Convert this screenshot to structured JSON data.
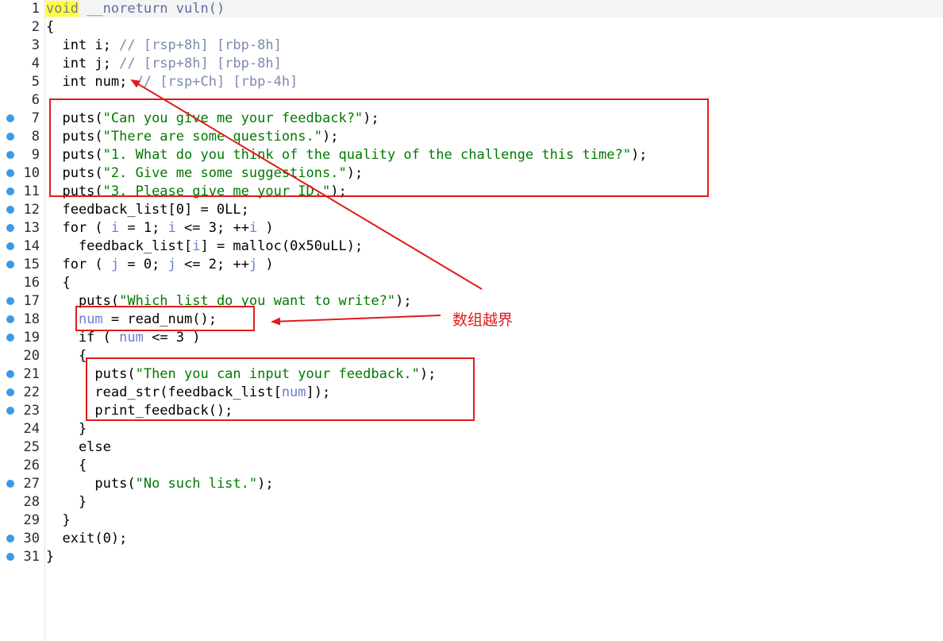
{
  "editor": {
    "lines": [
      {
        "num": "1",
        "bp": false,
        "tokens": [
          {
            "t": "void",
            "c": "kh"
          },
          {
            "t": " __noreturn vuln()",
            "c": "k"
          }
        ]
      },
      {
        "num": "2",
        "bp": false,
        "tokens": [
          {
            "t": "{",
            "c": "p"
          }
        ]
      },
      {
        "num": "3",
        "bp": false,
        "tokens": [
          {
            "t": "  int i; ",
            "c": "p"
          },
          {
            "t": "// [rsp+8h] [rbp-8h]",
            "c": "c"
          }
        ]
      },
      {
        "num": "4",
        "bp": false,
        "tokens": [
          {
            "t": "  int j; ",
            "c": "p"
          },
          {
            "t": "// [rsp+8h] [rbp-8h]",
            "c": "c"
          }
        ]
      },
      {
        "num": "5",
        "bp": false,
        "tokens": [
          {
            "t": "  int num; ",
            "c": "p"
          },
          {
            "t": "// [rsp+Ch] [rbp-4h]",
            "c": "c"
          }
        ]
      },
      {
        "num": "6",
        "bp": false,
        "tokens": []
      },
      {
        "num": "7",
        "bp": true,
        "tokens": [
          {
            "t": "  puts(",
            "c": "p"
          },
          {
            "t": "\"Can you give me your feedback?\"",
            "c": "s"
          },
          {
            "t": ");",
            "c": "p"
          }
        ]
      },
      {
        "num": "8",
        "bp": true,
        "tokens": [
          {
            "t": "  puts(",
            "c": "p"
          },
          {
            "t": "\"There are some questions.\"",
            "c": "s"
          },
          {
            "t": ");",
            "c": "p"
          }
        ]
      },
      {
        "num": "9",
        "bp": true,
        "tokens": [
          {
            "t": "  puts(",
            "c": "p"
          },
          {
            "t": "\"1. What do you think of the quality of the challenge this time?\"",
            "c": "s"
          },
          {
            "t": ");",
            "c": "p"
          }
        ]
      },
      {
        "num": "10",
        "bp": true,
        "tokens": [
          {
            "t": "  puts(",
            "c": "p"
          },
          {
            "t": "\"2. Give me some suggestions.\"",
            "c": "s"
          },
          {
            "t": ");",
            "c": "p"
          }
        ]
      },
      {
        "num": "11",
        "bp": true,
        "tokens": [
          {
            "t": "  puts(",
            "c": "p"
          },
          {
            "t": "\"3. Please give me your ID.\"",
            "c": "s"
          },
          {
            "t": ");",
            "c": "p"
          }
        ]
      },
      {
        "num": "12",
        "bp": true,
        "tokens": [
          {
            "t": "  feedback_list[0] = 0LL;",
            "c": "p"
          }
        ]
      },
      {
        "num": "13",
        "bp": true,
        "tokens": [
          {
            "t": "  for ( ",
            "c": "p"
          },
          {
            "t": "i",
            "c": "v"
          },
          {
            "t": " = 1; ",
            "c": "p"
          },
          {
            "t": "i",
            "c": "v"
          },
          {
            "t": " <= 3; ++",
            "c": "p"
          },
          {
            "t": "i",
            "c": "v"
          },
          {
            "t": " )",
            "c": "p"
          }
        ]
      },
      {
        "num": "14",
        "bp": true,
        "tokens": [
          {
            "t": "    feedback_list[",
            "c": "p"
          },
          {
            "t": "i",
            "c": "v"
          },
          {
            "t": "] = malloc(0x50uLL);",
            "c": "p"
          }
        ]
      },
      {
        "num": "15",
        "bp": true,
        "tokens": [
          {
            "t": "  for ( ",
            "c": "p"
          },
          {
            "t": "j",
            "c": "v"
          },
          {
            "t": " = 0; ",
            "c": "p"
          },
          {
            "t": "j",
            "c": "v"
          },
          {
            "t": " <= 2; ++",
            "c": "p"
          },
          {
            "t": "j",
            "c": "v"
          },
          {
            "t": " )",
            "c": "p"
          }
        ]
      },
      {
        "num": "16",
        "bp": false,
        "tokens": [
          {
            "t": "  {",
            "c": "p"
          }
        ]
      },
      {
        "num": "17",
        "bp": true,
        "tokens": [
          {
            "t": "    puts(",
            "c": "p"
          },
          {
            "t": "\"Which list do you want to write?\"",
            "c": "s"
          },
          {
            "t": ");",
            "c": "p"
          }
        ]
      },
      {
        "num": "18",
        "bp": true,
        "tokens": [
          {
            "t": "    ",
            "c": "p"
          },
          {
            "t": "num",
            "c": "v"
          },
          {
            "t": " = read_num();",
            "c": "p"
          }
        ]
      },
      {
        "num": "19",
        "bp": true,
        "tokens": [
          {
            "t": "    if ( ",
            "c": "p"
          },
          {
            "t": "num",
            "c": "v"
          },
          {
            "t": " <= 3 )",
            "c": "p"
          }
        ]
      },
      {
        "num": "20",
        "bp": false,
        "tokens": [
          {
            "t": "    {",
            "c": "p"
          }
        ]
      },
      {
        "num": "21",
        "bp": true,
        "tokens": [
          {
            "t": "      puts(",
            "c": "p"
          },
          {
            "t": "\"Then you can input your feedback.\"",
            "c": "s"
          },
          {
            "t": ");",
            "c": "p"
          }
        ]
      },
      {
        "num": "22",
        "bp": true,
        "tokens": [
          {
            "t": "      read_str(feedback_list[",
            "c": "p"
          },
          {
            "t": "num",
            "c": "v"
          },
          {
            "t": "]);",
            "c": "p"
          }
        ]
      },
      {
        "num": "23",
        "bp": true,
        "tokens": [
          {
            "t": "      print_feedback();",
            "c": "p"
          }
        ]
      },
      {
        "num": "24",
        "bp": false,
        "tokens": [
          {
            "t": "    }",
            "c": "p"
          }
        ]
      },
      {
        "num": "25",
        "bp": false,
        "tokens": [
          {
            "t": "    else",
            "c": "p"
          }
        ]
      },
      {
        "num": "26",
        "bp": false,
        "tokens": [
          {
            "t": "    {",
            "c": "p"
          }
        ]
      },
      {
        "num": "27",
        "bp": true,
        "tokens": [
          {
            "t": "      puts(",
            "c": "p"
          },
          {
            "t": "\"No such list.\"",
            "c": "s"
          },
          {
            "t": ");",
            "c": "p"
          }
        ]
      },
      {
        "num": "28",
        "bp": false,
        "tokens": [
          {
            "t": "    }",
            "c": "p"
          }
        ]
      },
      {
        "num": "29",
        "bp": false,
        "tokens": [
          {
            "t": "  }",
            "c": "p"
          }
        ]
      },
      {
        "num": "30",
        "bp": true,
        "tokens": [
          {
            "t": "  exit(0);",
            "c": "p"
          }
        ]
      },
      {
        "num": "31",
        "bp": true,
        "tokens": [
          {
            "t": "}",
            "c": "p"
          }
        ]
      }
    ]
  },
  "annotation": {
    "label": "数组越界",
    "color": "#e01b1b"
  },
  "colors": {
    "string": "#007a00",
    "variable": "#6b7fd0",
    "comment": "#7c8ab0",
    "keyword_highlight": "#ffff40",
    "breakpoint": "#3b9ae8"
  }
}
